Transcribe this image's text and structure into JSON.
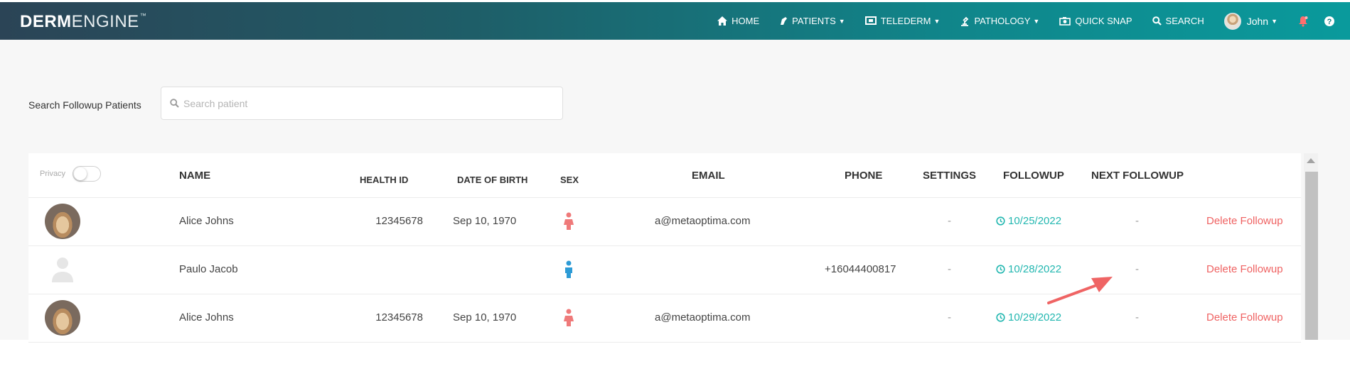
{
  "brand": {
    "bold": "DERM",
    "light": "ENGINE",
    "tm": "™"
  },
  "nav": {
    "home": "HOME",
    "patients": "PATIENTS",
    "telederm": "TELEDERM",
    "pathology": "PATHOLOGY",
    "quick_snap": "QUICK SNAP",
    "search": "SEARCH",
    "user": "John"
  },
  "search": {
    "label": "Search Followup Patients",
    "placeholder": "Search patient"
  },
  "table": {
    "privacy_label": "Privacy",
    "headers": {
      "name": "NAME",
      "health_id": "HEALTH ID",
      "dob": "DATE OF BIRTH",
      "sex": "SEX",
      "email": "EMAIL",
      "phone": "PHONE",
      "settings": "SETTINGS",
      "followup": "FOLLOWUP",
      "next_followup": "NEXT FOLLOWUP"
    },
    "rows": [
      {
        "name": "Alice Johns",
        "health_id": "12345678",
        "dob": "Sep 10, 1970",
        "sex": "female",
        "email": "a@metaoptima.com",
        "phone": "",
        "settings": "-",
        "followup": "10/25/2022",
        "next_followup": "-",
        "action": "Delete Followup",
        "avatar": "photo"
      },
      {
        "name": "Paulo Jacob",
        "health_id": "",
        "dob": "",
        "sex": "male",
        "email": "",
        "phone": "+16044400817",
        "settings": "-",
        "followup": "10/28/2022",
        "next_followup": "-",
        "action": "Delete Followup",
        "avatar": "placeholder"
      },
      {
        "name": "Alice Johns",
        "health_id": "12345678",
        "dob": "Sep 10, 1970",
        "sex": "female",
        "email": "a@metaoptima.com",
        "phone": "",
        "settings": "-",
        "followup": "10/29/2022",
        "next_followup": "-",
        "action": "Delete Followup",
        "avatar": "photo"
      }
    ]
  },
  "colors": {
    "accent_teal": "#22b7b0",
    "delete_red": "#ef6262",
    "female_icon": "#ef7a7a",
    "male_icon": "#2d9bd6",
    "annotation_arrow": "#ef6464"
  },
  "icons": [
    "home-icon",
    "patients-icon",
    "telederm-icon",
    "pathology-icon",
    "quick-snap-icon",
    "search-icon",
    "avatar",
    "notification-bell-icon",
    "help-icon",
    "clock-icon",
    "female-icon",
    "male-icon"
  ]
}
